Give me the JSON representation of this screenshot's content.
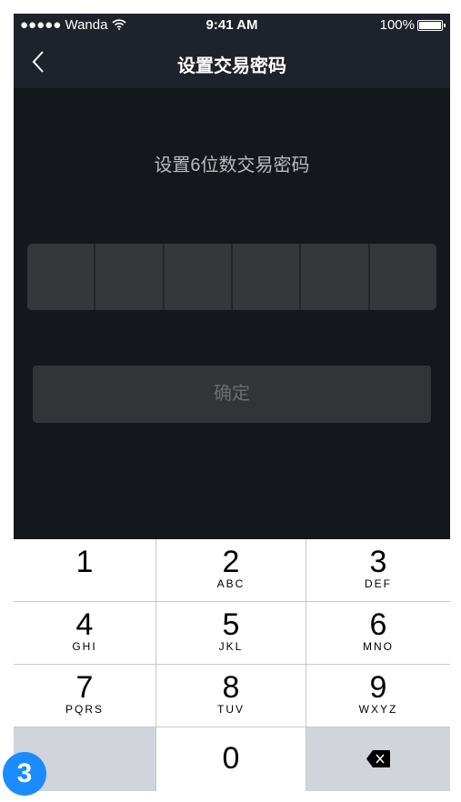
{
  "status_bar": {
    "carrier": "●●●●● Wanda",
    "time": "9:41 AM",
    "battery": "100%"
  },
  "nav": {
    "title": "设置交易密码"
  },
  "main": {
    "heading": "设置6位数交易密码",
    "pin_length": 6,
    "pin_filled": 0,
    "confirm_label": "确定"
  },
  "keypad": {
    "keys": [
      {
        "num": "1",
        "letters": ""
      },
      {
        "num": "2",
        "letters": "ABC"
      },
      {
        "num": "3",
        "letters": "DEF"
      },
      {
        "num": "4",
        "letters": "GHI"
      },
      {
        "num": "5",
        "letters": "JKL"
      },
      {
        "num": "6",
        "letters": "MNO"
      },
      {
        "num": "7",
        "letters": "PQRS"
      },
      {
        "num": "8",
        "letters": "TUV"
      },
      {
        "num": "9",
        "letters": "WXYZ"
      },
      {
        "num": "0",
        "letters": ""
      }
    ],
    "delete_icon": "backspace-icon"
  },
  "badge": "3",
  "colors": {
    "accent": "#1a8cff",
    "nav_bg": "#1e222a",
    "body_bg": "#14171b"
  }
}
